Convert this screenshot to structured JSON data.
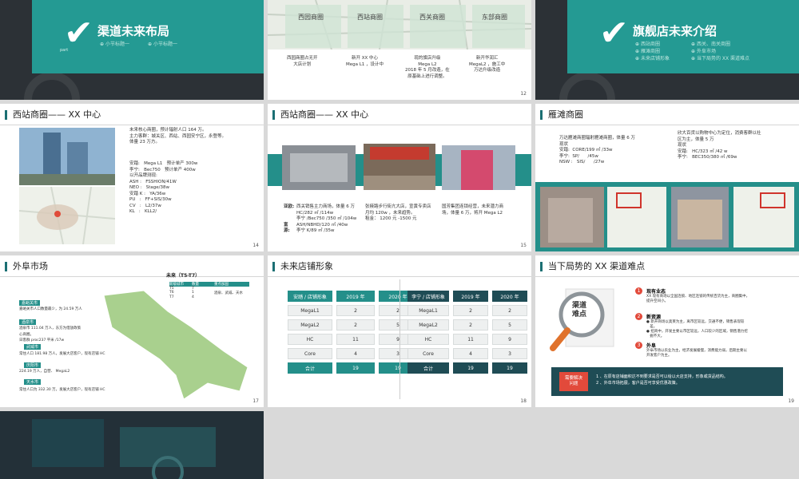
{
  "slide16": {
    "title": "渠道未来布局",
    "sub1": "小节标题一",
    "sub2": "小节标题一",
    "part": "part"
  },
  "slide12": {
    "labels": [
      "西园商圈",
      "西站商圈",
      "西关商圈",
      "东部商圈"
    ],
    "captions": [
      "西园商圈占无开\n大店计划",
      "新开 XX 中心\nMega L1 ，设计中",
      "现的旗店升级\nMega L2\n2018 年 5 月改造，在\n原基础上进行调整。",
      "新开华润汇\nMegaL2 ，施工中\n万达升级改造"
    ],
    "num": "12"
  },
  "slide13": {
    "title": "旗舰店未来介绍",
    "items": [
      "西站商圈",
      "西关、南关商圈",
      "雁滩商圈",
      "外阜市场",
      "未来店铺形象",
      "当下局势的 XX 渠道难点"
    ]
  },
  "slide14": {
    "title": "西站商圈—— XX 中心",
    "intro": "未来核心商圈，预计辐射人口 164 万。\n主力客群：城关区、西站、西园安宁区，永登等。\n体量 23 万方。",
    "brands": "安踏:   Mega L1   预计单产 300w\n李宁:   Bec750   预计单产 400w\n以开品牌测现:\nASH :   FSSHION/41W\nNEO :   Stage/38w\n安踏 K :   YA/36w\nPU   :   FF+SIS/30w\nCV   :   L2/37w\nKL   :   KLL2/",
    "num": "14"
  },
  "slide15": {
    "title": "西站商圈—— XX 中心",
    "left_labels": "亚欧:\n\n\n富\n源:",
    "left_text": "西关销售主力商场，体量 6 万\nHC/282 ㎡ /114w\n李宁 /Bec750 /350 ㎡ /104w\nASH/NBHD/120 ㎡ /40w\n李宁 K/89 ㎡ /35w",
    "mid_text": "张掖路步行街亢大店，宣黄专卖店\n月均 120w ，未来趋势。\n租金： 1200 元 -1500 元",
    "right_text": "国芳集团连锁经营，未来潜力商\n场，体量 6 万，将开 Mega L2",
    "num": "15"
  },
  "slide16b": {
    "title": "雁滩商圈",
    "left": "万达雁滩商圈辐射雁滩商圈，体量 6 万\n现状\n安踏:  CORE/199 ㎡ /33w\n李宁:  SP/      /45w\nNSW :   SIS/      /27w",
    "right": "欣大百货以购物中心为定位，消费客群以社\n区为主，体量 5 万\n现状\n安踏:   HC/323 ㎡ /42 w\n李宁:   BEC350/380 ㎡ /69w"
  },
  "slide17": {
    "title": "外阜市场",
    "table_title": "未来（T5-T7）",
    "headers": [
      "新级城市",
      "数量",
      "重点加固"
    ],
    "rows": [
      [
        "T5",
        "7",
        ""
      ],
      [
        "T6",
        "1",
        "酒泉、武威、天水"
      ],
      [
        "T7",
        "4",
        ""
      ]
    ],
    "cities": [
      {
        "name": "嘉峪关市",
        "text": "嘉峪关市人口数量最少，为 24.59 万人"
      },
      {
        "name": "酒泉市",
        "text": "酒泉市 111.04 万人，东方为借放政策\n心商圈。\n日客群 proc237 平米 /17w"
      },
      {
        "name": "武威市",
        "text": "常住人口 181.98 万人，发展大店客户，现有店铺 HC"
      },
      {
        "name": "庆阳市",
        "text": "224.19 万人，自营、 MegaL2"
      },
      {
        "name": "天水市",
        "text": "常住人口为 332.30 万，发展大店客户，现有店铺 HC"
      }
    ],
    "num": "17"
  },
  "slide18": {
    "title": "未来店铺形象",
    "left_headers": [
      "安踏 / 店铺形象",
      "2019 年",
      "2020 年"
    ],
    "left_rows": [
      [
        "MegaL1",
        "2",
        "2"
      ],
      [
        "MegaL2",
        "2",
        "5"
      ],
      [
        "HC",
        "11",
        "9"
      ],
      [
        "Core",
        "4",
        "3"
      ],
      [
        "合计",
        "19",
        "19"
      ]
    ],
    "right_headers": [
      "李宁 / 店铺形象",
      "2019 年",
      "2020 年"
    ],
    "right_rows": [
      [
        "MegaL1",
        "2",
        "2"
      ],
      [
        "MegaL2",
        "2",
        "5"
      ],
      [
        "HC",
        "11",
        "9"
      ],
      [
        "Core",
        "4",
        "3"
      ],
      [
        "合计",
        "19",
        "19"
      ]
    ],
    "num": "18"
  },
  "slide19": {
    "title": "当下局势的 XX 渠道难点",
    "magnifier_text": "渠道\n难点",
    "points": [
      {
        "n": "1",
        "h": "现有业态",
        "t": "XX 现有商场以全国连锁、地区连锁的传统百货为主，商圈集中，\n提升空间小。"
      },
      {
        "n": "2",
        "h": "新资源",
        "t": "● 新开商场以奥莱为主，离市区较远，交通不便，销售表现较\n   差。\n● 招商中，开发主要以市区较远，人口较少的区域，销售潜力挖\n   掘不大。"
      },
      {
        "n": "3",
        "h": "外阜",
        "t": "外阜市场以农业为主，经济发展缓慢，消费能力弱，后期主要以\n开发客户为主。"
      }
    ],
    "badge": "需要解决\n问题",
    "solve": "1 、在原有店铺面积达不到要求是否可以给以大店支持，形象或货品结构。\n2 、外阜市场拓展，客户是否可享受优惠政策。",
    "num": "19"
  }
}
